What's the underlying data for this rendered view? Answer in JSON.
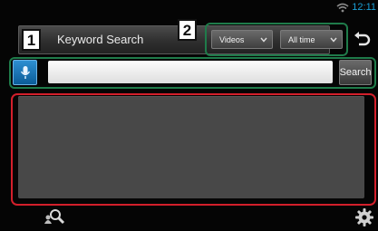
{
  "status": {
    "time": "12:11",
    "wifi_icon": "wifi-icon"
  },
  "header": {
    "title": "Keyword Search"
  },
  "filters": {
    "type_selected": "Videos",
    "time_selected": "All time"
  },
  "search": {
    "input_value": "",
    "button_label": "Search"
  },
  "results": {
    "items": []
  },
  "callouts": {
    "one": "1",
    "two": "2"
  },
  "colors": {
    "accent_blue": "#1a9fd6",
    "callout_green": "#1f7b4a",
    "callout_red": "#d31f2b"
  }
}
